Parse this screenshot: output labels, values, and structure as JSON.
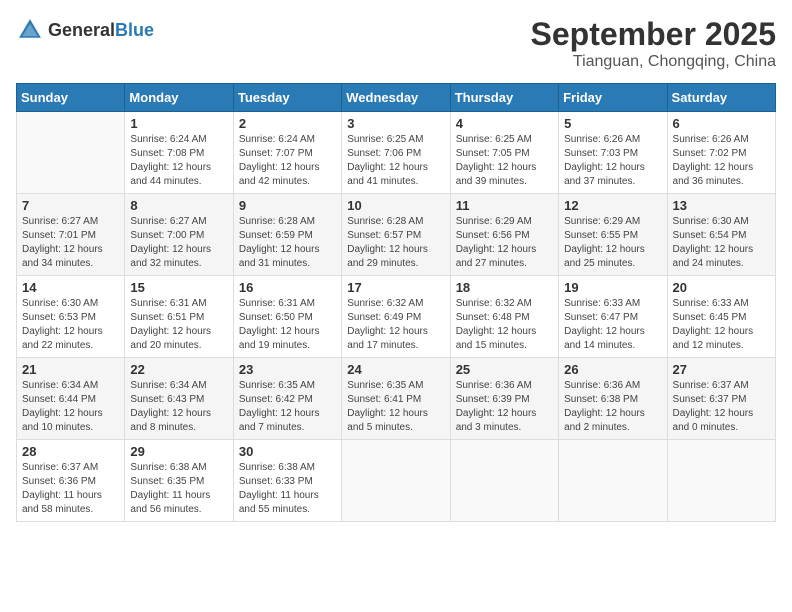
{
  "header": {
    "logo_general": "General",
    "logo_blue": "Blue",
    "month_year": "September 2025",
    "location": "Tianguan, Chongqing, China"
  },
  "weekdays": [
    "Sunday",
    "Monday",
    "Tuesday",
    "Wednesday",
    "Thursday",
    "Friday",
    "Saturday"
  ],
  "weeks": [
    [
      {
        "day": "",
        "sunrise": "",
        "sunset": "",
        "daylight": ""
      },
      {
        "day": "1",
        "sunrise": "6:24 AM",
        "sunset": "7:08 PM",
        "daylight": "12 hours and 44 minutes."
      },
      {
        "day": "2",
        "sunrise": "6:24 AM",
        "sunset": "7:07 PM",
        "daylight": "12 hours and 42 minutes."
      },
      {
        "day": "3",
        "sunrise": "6:25 AM",
        "sunset": "7:06 PM",
        "daylight": "12 hours and 41 minutes."
      },
      {
        "day": "4",
        "sunrise": "6:25 AM",
        "sunset": "7:05 PM",
        "daylight": "12 hours and 39 minutes."
      },
      {
        "day": "5",
        "sunrise": "6:26 AM",
        "sunset": "7:03 PM",
        "daylight": "12 hours and 37 minutes."
      },
      {
        "day": "6",
        "sunrise": "6:26 AM",
        "sunset": "7:02 PM",
        "daylight": "12 hours and 36 minutes."
      }
    ],
    [
      {
        "day": "7",
        "sunrise": "6:27 AM",
        "sunset": "7:01 PM",
        "daylight": "12 hours and 34 minutes."
      },
      {
        "day": "8",
        "sunrise": "6:27 AM",
        "sunset": "7:00 PM",
        "daylight": "12 hours and 32 minutes."
      },
      {
        "day": "9",
        "sunrise": "6:28 AM",
        "sunset": "6:59 PM",
        "daylight": "12 hours and 31 minutes."
      },
      {
        "day": "10",
        "sunrise": "6:28 AM",
        "sunset": "6:57 PM",
        "daylight": "12 hours and 29 minutes."
      },
      {
        "day": "11",
        "sunrise": "6:29 AM",
        "sunset": "6:56 PM",
        "daylight": "12 hours and 27 minutes."
      },
      {
        "day": "12",
        "sunrise": "6:29 AM",
        "sunset": "6:55 PM",
        "daylight": "12 hours and 25 minutes."
      },
      {
        "day": "13",
        "sunrise": "6:30 AM",
        "sunset": "6:54 PM",
        "daylight": "12 hours and 24 minutes."
      }
    ],
    [
      {
        "day": "14",
        "sunrise": "6:30 AM",
        "sunset": "6:53 PM",
        "daylight": "12 hours and 22 minutes."
      },
      {
        "day": "15",
        "sunrise": "6:31 AM",
        "sunset": "6:51 PM",
        "daylight": "12 hours and 20 minutes."
      },
      {
        "day": "16",
        "sunrise": "6:31 AM",
        "sunset": "6:50 PM",
        "daylight": "12 hours and 19 minutes."
      },
      {
        "day": "17",
        "sunrise": "6:32 AM",
        "sunset": "6:49 PM",
        "daylight": "12 hours and 17 minutes."
      },
      {
        "day": "18",
        "sunrise": "6:32 AM",
        "sunset": "6:48 PM",
        "daylight": "12 hours and 15 minutes."
      },
      {
        "day": "19",
        "sunrise": "6:33 AM",
        "sunset": "6:47 PM",
        "daylight": "12 hours and 14 minutes."
      },
      {
        "day": "20",
        "sunrise": "6:33 AM",
        "sunset": "6:45 PM",
        "daylight": "12 hours and 12 minutes."
      }
    ],
    [
      {
        "day": "21",
        "sunrise": "6:34 AM",
        "sunset": "6:44 PM",
        "daylight": "12 hours and 10 minutes."
      },
      {
        "day": "22",
        "sunrise": "6:34 AM",
        "sunset": "6:43 PM",
        "daylight": "12 hours and 8 minutes."
      },
      {
        "day": "23",
        "sunrise": "6:35 AM",
        "sunset": "6:42 PM",
        "daylight": "12 hours and 7 minutes."
      },
      {
        "day": "24",
        "sunrise": "6:35 AM",
        "sunset": "6:41 PM",
        "daylight": "12 hours and 5 minutes."
      },
      {
        "day": "25",
        "sunrise": "6:36 AM",
        "sunset": "6:39 PM",
        "daylight": "12 hours and 3 minutes."
      },
      {
        "day": "26",
        "sunrise": "6:36 AM",
        "sunset": "6:38 PM",
        "daylight": "12 hours and 2 minutes."
      },
      {
        "day": "27",
        "sunrise": "6:37 AM",
        "sunset": "6:37 PM",
        "daylight": "12 hours and 0 minutes."
      }
    ],
    [
      {
        "day": "28",
        "sunrise": "6:37 AM",
        "sunset": "6:36 PM",
        "daylight": "11 hours and 58 minutes."
      },
      {
        "day": "29",
        "sunrise": "6:38 AM",
        "sunset": "6:35 PM",
        "daylight": "11 hours and 56 minutes."
      },
      {
        "day": "30",
        "sunrise": "6:38 AM",
        "sunset": "6:33 PM",
        "daylight": "11 hours and 55 minutes."
      },
      {
        "day": "",
        "sunrise": "",
        "sunset": "",
        "daylight": ""
      },
      {
        "day": "",
        "sunrise": "",
        "sunset": "",
        "daylight": ""
      },
      {
        "day": "",
        "sunrise": "",
        "sunset": "",
        "daylight": ""
      },
      {
        "day": "",
        "sunrise": "",
        "sunset": "",
        "daylight": ""
      }
    ]
  ]
}
